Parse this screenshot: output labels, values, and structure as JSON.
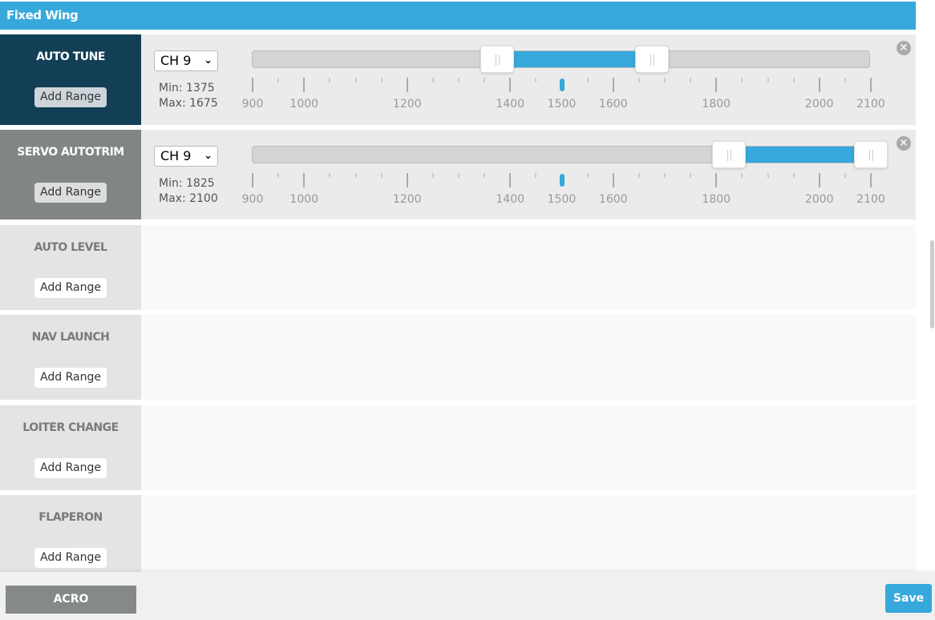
{
  "header": {
    "title": "Fixed Wing"
  },
  "scale": {
    "min": 900,
    "max": 2100,
    "labels": [
      900,
      1000,
      1200,
      1400,
      1500,
      1600,
      1800,
      2000,
      2100
    ]
  },
  "modes": [
    {
      "name": "AUTO TUNE",
      "add": "Add Range",
      "state": "dark",
      "channel": "CH 9",
      "min_label": "Min: 1375",
      "max_label": "Max: 1675",
      "range": [
        1375,
        1675
      ],
      "current": 1500
    },
    {
      "name": "SERVO AUTOTRIM",
      "add": "Add Range",
      "state": "grey",
      "channel": "CH 9",
      "min_label": "Min: 1825",
      "max_label": "Max: 2100",
      "range": [
        1825,
        2100
      ],
      "current": 1500
    },
    {
      "name": "AUTO LEVEL",
      "add": "Add Range"
    },
    {
      "name": "NAV LAUNCH",
      "add": "Add Range"
    },
    {
      "name": "LOITER CHANGE",
      "add": "Add Range"
    },
    {
      "name": "FLAPERON",
      "add": "Add Range"
    }
  ],
  "footer": {
    "mode": "ACRO",
    "save": "Save"
  },
  "colors": {
    "accent": "#37a8db",
    "active_dark": "#123f55",
    "active_grey": "#818583"
  }
}
